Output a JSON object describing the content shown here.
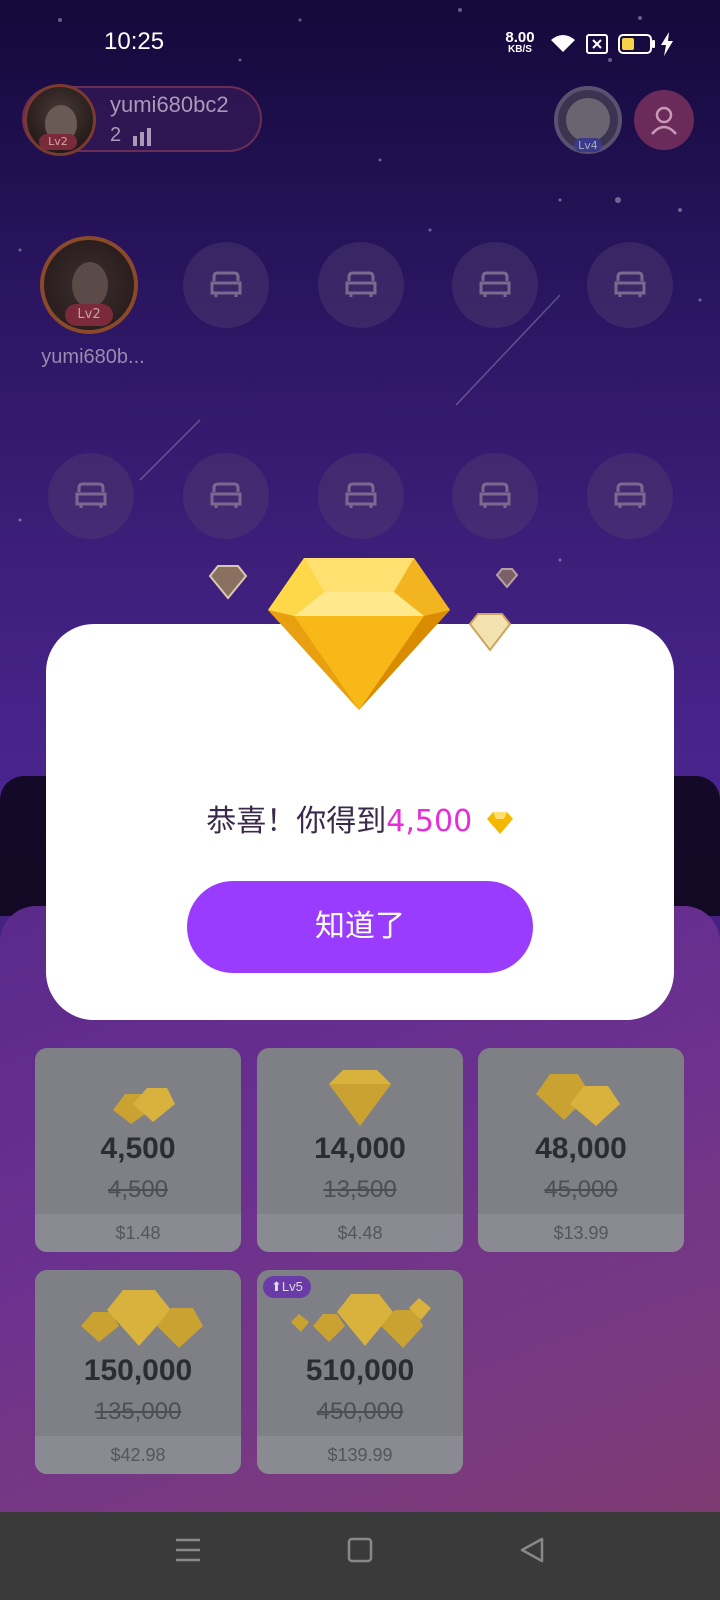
{
  "status_bar": {
    "time": "10:25",
    "net_speed_value": "8.00",
    "net_speed_unit": "KB/S",
    "icons": [
      "wifi-icon",
      "sim-x-icon",
      "battery-icon",
      "charging-icon"
    ]
  },
  "header": {
    "host_name": "yumi680bc2",
    "host_level": "Lv2",
    "viewer_count": "2",
    "badge_level": "Lv4"
  },
  "seats": {
    "host_name": "yumi680b...",
    "host_level": "Lv2"
  },
  "shop": {
    "packages": [
      {
        "amount": "4,500",
        "original": "4,500",
        "price": "$1.48",
        "tag": ""
      },
      {
        "amount": "14,000",
        "original": "13,500",
        "price": "$4.48",
        "tag": ""
      },
      {
        "amount": "48,000",
        "original": "45,000",
        "price": "$13.99",
        "tag": ""
      },
      {
        "amount": "150,000",
        "original": "135,000",
        "price": "$42.98",
        "tag": ""
      },
      {
        "amount": "510,000",
        "original": "450,000",
        "price": "$139.99",
        "tag": "Lv5"
      }
    ]
  },
  "dialog": {
    "message_prefix": "恭喜！你得到",
    "amount": "4,500",
    "button_label": "知道了"
  },
  "colors": {
    "accent": "#9a3cff",
    "amount_highlight": "#e62fd8",
    "gem_gold": "#f5c518"
  }
}
